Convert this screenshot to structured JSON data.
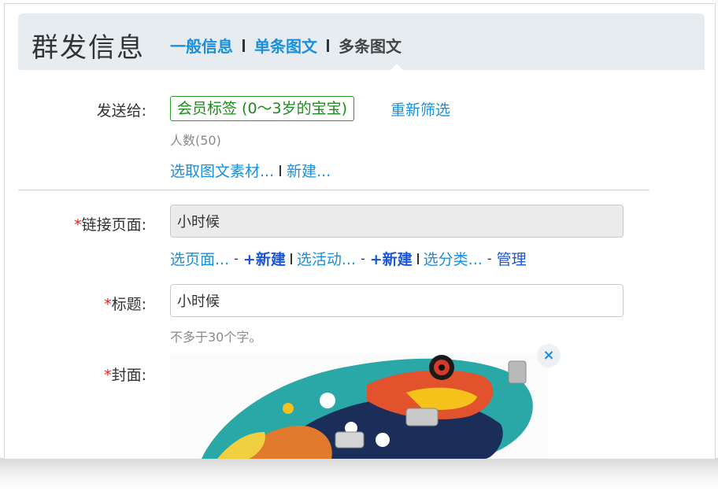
{
  "header": {
    "title": "群发信息",
    "tabs": [
      {
        "label": "一般信息"
      },
      {
        "label": "单条图文"
      },
      {
        "label": "多条图文"
      }
    ]
  },
  "send_to": {
    "label": "发送给:",
    "tag": "会员标签 (0～3岁的宝宝)",
    "refilter": "重新筛选",
    "count": "人数(50)",
    "pick_material": "选取图文素材...",
    "new_link": "新建..."
  },
  "link_page": {
    "required_mark": "*",
    "label": "链接页面:",
    "value": "小时候",
    "links": {
      "pick_page": "选页面...",
      "new1": "+新建",
      "pick_activity": "选活动...",
      "new2": "+新建",
      "pick_category": "选分类...",
      "manage": "管理",
      "dash": "-"
    }
  },
  "title_field": {
    "required_mark": "*",
    "label": "标题:",
    "value": "小时候",
    "hint": "不多于30个字。"
  },
  "cover": {
    "required_mark": "*",
    "label": "封面:",
    "close": "×"
  }
}
